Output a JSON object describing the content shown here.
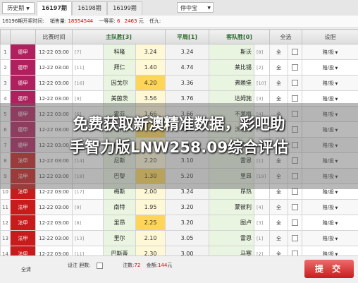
{
  "topbar": {
    "history_label": "历史期",
    "tabs": [
      "16197期",
      "16198期",
      "16199期"
    ],
    "active_tab": 0,
    "filter_label": "停中宝"
  },
  "infobar": {
    "period_text": "16196期开奖时间:",
    "sales_label": "销售量:",
    "sales_value": "18554544",
    "first_prize_label": "一等奖:",
    "first_prize_value": "6",
    "prize_amount": "2463",
    "unit": "元",
    "nine_label": "任九:"
  },
  "table": {
    "headers": {
      "num": "",
      "league": "",
      "time": "比赛时间",
      "home": "主队胜[3]",
      "draw": "平局[1]",
      "away": "客队胜[0]",
      "all": "全选",
      "opt": "设胆"
    },
    "rows": [
      {
        "num": "1",
        "league": "德甲",
        "color": "#b0205e",
        "time": "12-22 03:00",
        "rank_h": "[7]",
        "home": "科隆",
        "o3": "3.24",
        "o1": "3.24",
        "away": "斯沃",
        "rank_a": "[8]",
        "bet": "赔/投"
      },
      {
        "num": "2",
        "league": "德甲",
        "color": "#b0205e",
        "time": "12-22 03:00",
        "rank_h": "[11]",
        "home": "拜仁",
        "o3": "1.40",
        "o1": "4.74",
        "o0": "7.43",
        "away": "莱比锡",
        "rank_a": "[2]",
        "bet": "赔/投"
      },
      {
        "num": "3",
        "league": "德甲",
        "color": "#b0205e",
        "time": "12-22 03:00",
        "rank_h": "[16]",
        "home": "因戈尔",
        "o3": "4.20",
        "o1": "3.36",
        "o0": "1.85",
        "away": "弗赖堡",
        "rank_a": "[10]",
        "bet": "赔/投"
      },
      {
        "num": "4",
        "league": "德甲",
        "color": "#b0205e",
        "time": "12-22 03:00",
        "rank_h": "[9]",
        "home": "美茵茨",
        "o3": "3.56",
        "o1": "3.76",
        "o0": "6.00",
        "away": "达姆施",
        "rank_a": "[3]",
        "bet": "赔/投"
      },
      {
        "num": "5",
        "league": "德甲",
        "color": "#b0205e",
        "time": "12-22 03:00",
        "rank_h": "[5]",
        "home": "霍芬",
        "o3": "1.66",
        "o1": "3.66",
        "o0": "4.20",
        "away": "不莱梅",
        "rank_a": "[4]",
        "bet": "赔/投"
      },
      {
        "num": "6",
        "league": "德甲",
        "color": "#b0205e",
        "time": "12-22 03:00",
        "rank_h": "[13]",
        "home": "柏林",
        "o3": "2.10",
        "o1": "3.20",
        "o0": "3.40",
        "away": "沃尔夫",
        "rank_a": "[6]",
        "bet": "赔/投"
      },
      {
        "num": "7",
        "league": "德甲",
        "color": "#b0205e",
        "time": "12-22 03:00",
        "rank_h": "[15]",
        "home": "门兴",
        "o3": "1.90",
        "o1": "3.40",
        "o0": "4.00",
        "away": "奥格斯",
        "rank_a": "[12]",
        "bet": "赔/投"
      },
      {
        "num": "8",
        "league": "法甲",
        "color": "#c81c1c",
        "time": "12-22 03:00",
        "rank_h": "[14]",
        "home": "尼斯",
        "o3": "2.20",
        "o1": "3.10",
        "o0": "3.30",
        "away": "雷恩",
        "rank_a": "[1]",
        "bet": "赔/投"
      },
      {
        "num": "9",
        "league": "法甲",
        "color": "#c81c1c",
        "time": "12-22 03:00",
        "rank_h": "[18]",
        "home": "巴黎",
        "o3": "1.30",
        "o1": "5.20",
        "o0": "9.00",
        "away": "里昂",
        "rank_a": "[19]",
        "bet": "赔/投"
      },
      {
        "num": "10",
        "league": "法甲",
        "color": "#c81c1c",
        "time": "12-22 03:00",
        "rank_h": "[17]",
        "home": "梅斯",
        "o3": "2.00",
        "o1": "3.24",
        "o0": "",
        "away": "昂热",
        "rank_a": "",
        "bet": "赔/投"
      },
      {
        "num": "11",
        "league": "法甲",
        "color": "#c81c1c",
        "time": "12-22 03:00",
        "rank_h": "[9]",
        "home": "南特",
        "o3": "1.95",
        "o1": "3.20",
        "o0": "3.84",
        "away": "蒙彼利",
        "rank_a": "[4]",
        "bet": "赔/投"
      },
      {
        "num": "12",
        "league": "法甲",
        "color": "#c81c1c",
        "time": "12-22 03:00",
        "rank_h": "[8]",
        "home": "里昂",
        "o3": "2.25",
        "o1": "3.20",
        "o0": "3.12",
        "away": "图卢",
        "rank_a": "[3]",
        "bet": "赔/投"
      },
      {
        "num": "13",
        "league": "法甲",
        "color": "#c81c1c",
        "time": "12-22 03:00",
        "rank_h": "[13]",
        "home": "里尔",
        "o3": "2.10",
        "o1": "3.05",
        "o0": "3.24",
        "away": "雷恩",
        "rank_a": "[1]",
        "bet": "赔/投"
      },
      {
        "num": "14",
        "league": "法甲",
        "color": "#c81c1c",
        "time": "12-22 03:00",
        "rank_h": "[11]",
        "home": "巴斯蒂",
        "o3": "2.30",
        "o1": "3.00",
        "o0": "3.32",
        "away": "马赛",
        "rank_a": "[2]",
        "bet": "赔/投"
      }
    ],
    "all_label": "全"
  },
  "bottom": {
    "clear_label": "全清",
    "mode_label": "设注 胆数:",
    "bets_label": "注数:",
    "bets_value": "72",
    "amount_label": "金额:",
    "amount_value": "144",
    "amount_unit": "元",
    "submit_label": "提 交"
  },
  "overlay": {
    "line1": "免费获取新澳精准数据，彩吧助",
    "line2": "手智力版LNW258.09综合评估"
  },
  "colors": {
    "german_league": "#b0205e",
    "french_league": "#c81c1c",
    "selected_odds": "#ffd557",
    "submit": "#d42a2a"
  }
}
